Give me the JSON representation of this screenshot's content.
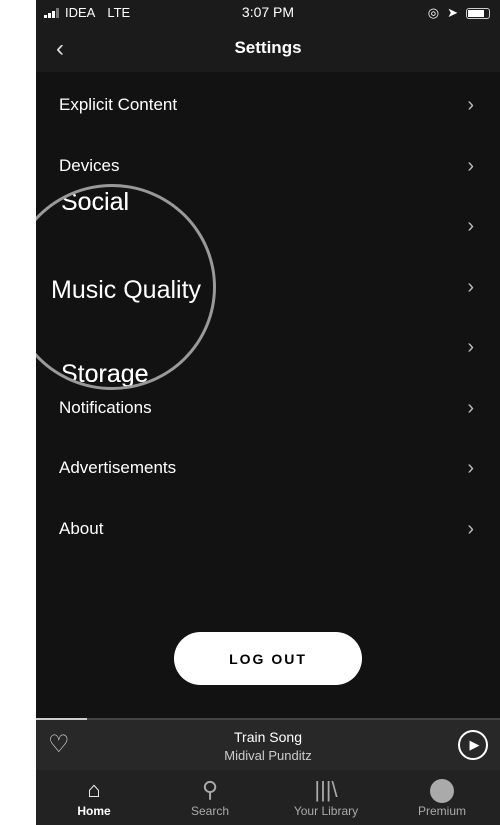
{
  "status": {
    "carrier": "IDEA",
    "network": "LTE",
    "time": "3:07 PM"
  },
  "header": {
    "title": "Settings"
  },
  "settings": [
    {
      "label": "Explicit Content"
    },
    {
      "label": "Devices"
    },
    {
      "label": "Social"
    },
    {
      "label": "Music Quality"
    },
    {
      "label": "Storage"
    },
    {
      "label": "Notifications"
    },
    {
      "label": "Advertisements"
    },
    {
      "label": "About"
    }
  ],
  "magnifier": {
    "above": "ocial",
    "focus": "Music Quality",
    "below": "orage"
  },
  "logout_label": "LOG OUT",
  "player": {
    "title": "Train Song",
    "artist": "Midival Punditz",
    "progress": 0.11
  },
  "tabs": [
    {
      "label": "Home",
      "icon": "home-icon"
    },
    {
      "label": "Search",
      "icon": "search-icon"
    },
    {
      "label": "Your Library",
      "icon": "library-icon"
    },
    {
      "label": "Premium",
      "icon": "spotify-icon"
    }
  ]
}
